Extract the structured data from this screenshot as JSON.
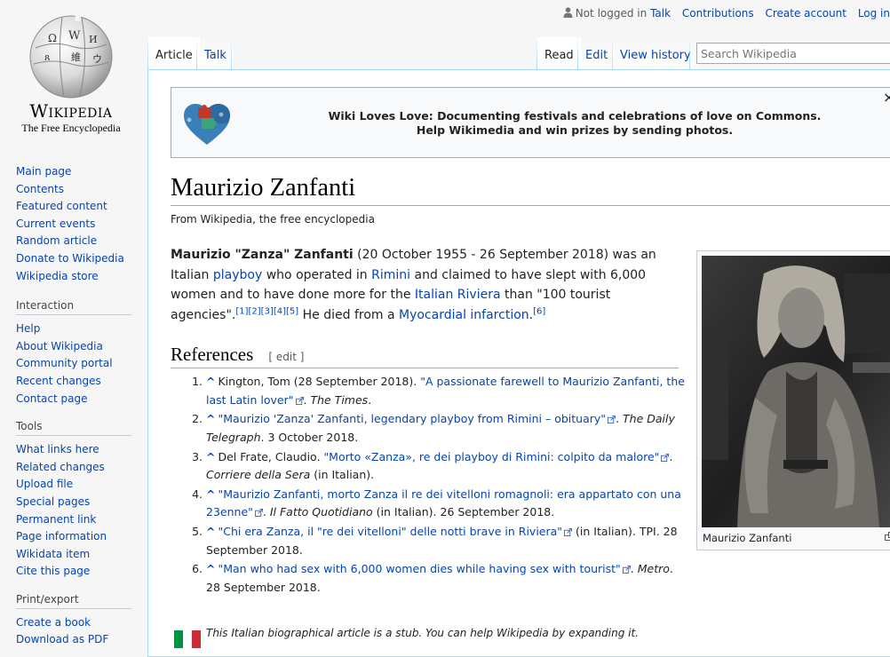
{
  "logo": {
    "wordmark": "Wikipedia",
    "tagline": "The Free Encyclopedia"
  },
  "sidebar": {
    "main": [
      "Main page",
      "Contents",
      "Featured content",
      "Current events",
      "Random article",
      "Donate to Wikipedia",
      "Wikipedia store"
    ],
    "interaction": {
      "heading": "Interaction",
      "items": [
        "Help",
        "About Wikipedia",
        "Community portal",
        "Recent changes",
        "Contact page"
      ]
    },
    "tools": {
      "heading": "Tools",
      "items": [
        "What links here",
        "Related changes",
        "Upload file",
        "Special pages",
        "Permanent link",
        "Page information",
        "Wikidata item",
        "Cite this page"
      ]
    },
    "print": {
      "heading": "Print/export",
      "items": [
        "Create a book",
        "Download as PDF"
      ]
    }
  },
  "personal": {
    "not_logged_in": "Not logged in",
    "talk": "Talk",
    "contributions": "Contributions",
    "create_account": "Create account",
    "login": "Log in"
  },
  "tabs": {
    "article": "Article",
    "talk": "Talk",
    "read": "Read",
    "edit": "Edit",
    "history": "View history"
  },
  "search": {
    "placeholder": "Search Wikipedia"
  },
  "banner": {
    "line1": "Wiki Loves Love: Documenting festivals and celebrations of love on Commons.",
    "line2": "Help Wikimedia and win prizes by sending photos.",
    "close": "×"
  },
  "page": {
    "title": "Maurizio Zanfanti",
    "from": "From Wikipedia, the free encyclopedia",
    "lead": {
      "name": "Maurizio \"Zanza\" Zanfanti",
      "t1": " (20 October 1955 - 26 September 2018) was an Italian ",
      "l1": "playboy",
      "t2": " who operated in ",
      "l2": "Rimini",
      "t3": " and claimed to have slept with 6,000 women and to have done more for the ",
      "l3": "Italian Riviera",
      "t4": " than \"100 tourist agencies\".",
      "cites1": "[1][2][3][4][5]",
      "t5": " He died from a ",
      "l4": "Myocardial infarction",
      "t6": ".",
      "cites2": "[6]"
    },
    "references_heading": "References",
    "edit_label": "[ edit ]",
    "references": [
      {
        "author": "Kington, Tom (28 September 2018). ",
        "title": "\"A passionate farewell to Maurizio Zanfanti, the last Latin lover\"",
        "rest_italic": "The Times",
        "rest": "."
      },
      {
        "author": "",
        "title": "\"Maurizio 'Zanza' Zanfanti, legendary playboy from Rimini – obituary\"",
        "rest_italic": "The Daily Telegraph",
        "rest": ". 3 October 2018."
      },
      {
        "author": "Del Frate, Claudio. ",
        "title": "\"Morto «Zanza», re dei playboy di Rimini: colpito da malore\"",
        "rest_italic": "Corriere della Sera",
        "rest": " (in Italian)."
      },
      {
        "author": "",
        "title": "\"Maurizio Zanfanti, morto Zanza il re dei vitelloni romagnoli: era appartato con una 23enne\"",
        "rest_italic": "Il Fatto Quotidiano",
        "rest": " (in Italian). 26 September 2018."
      },
      {
        "author": "",
        "title": "\"Chi era Zanza, il \"re dei vitelloni\" delle notti brave in Riviera\"",
        "rest_italic": "",
        "rest": " (in Italian). TPI. 28 September 2018."
      },
      {
        "author": "",
        "title": "\"Man who had sex with 6,000 women dies while having sex with tourist\"",
        "rest_italic": "Metro",
        "rest": ". 28 September 2018."
      }
    ],
    "infobox_caption": "Maurizio Zanfanti",
    "stub_text": "This Italian biographical article is a stub. You can help Wikipedia by expanding it."
  }
}
